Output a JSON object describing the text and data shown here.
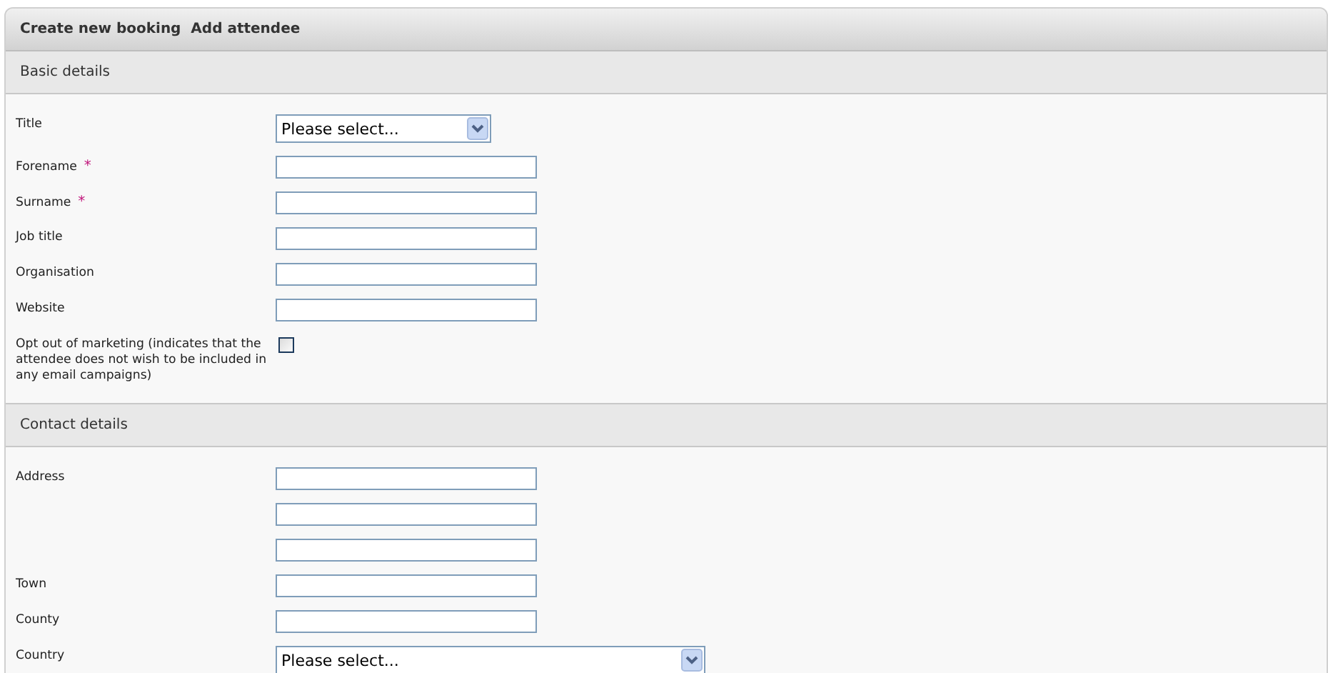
{
  "panel": {
    "title": "Create new booking  Add attendee"
  },
  "sections": [
    {
      "heading": "Basic details",
      "fields": [
        {
          "kind": "short-select",
          "label": "Title",
          "value": "Please select..."
        },
        {
          "kind": "text",
          "label": "Forename",
          "required_mark": "*"
        },
        {
          "kind": "text",
          "label": "Surname",
          "required_mark": "*"
        },
        {
          "kind": "text",
          "label": "Job title"
        },
        {
          "kind": "text",
          "label": "Organisation"
        },
        {
          "kind": "text",
          "label": "Website"
        },
        {
          "kind": "checkbox",
          "label": "Opt out of marketing (indicates that the attendee does not wish to be included in any email campaigns)",
          "checked": false
        }
      ]
    },
    {
      "heading": "Contact details",
      "fields": [
        {
          "kind": "text",
          "label": "Address"
        },
        {
          "kind": "text"
        },
        {
          "kind": "text"
        },
        {
          "kind": "text",
          "label": "Town"
        },
        {
          "kind": "text",
          "label": "County"
        },
        {
          "kind": "long-select",
          "label": "Country",
          "value": "Please select..."
        }
      ]
    }
  ]
}
